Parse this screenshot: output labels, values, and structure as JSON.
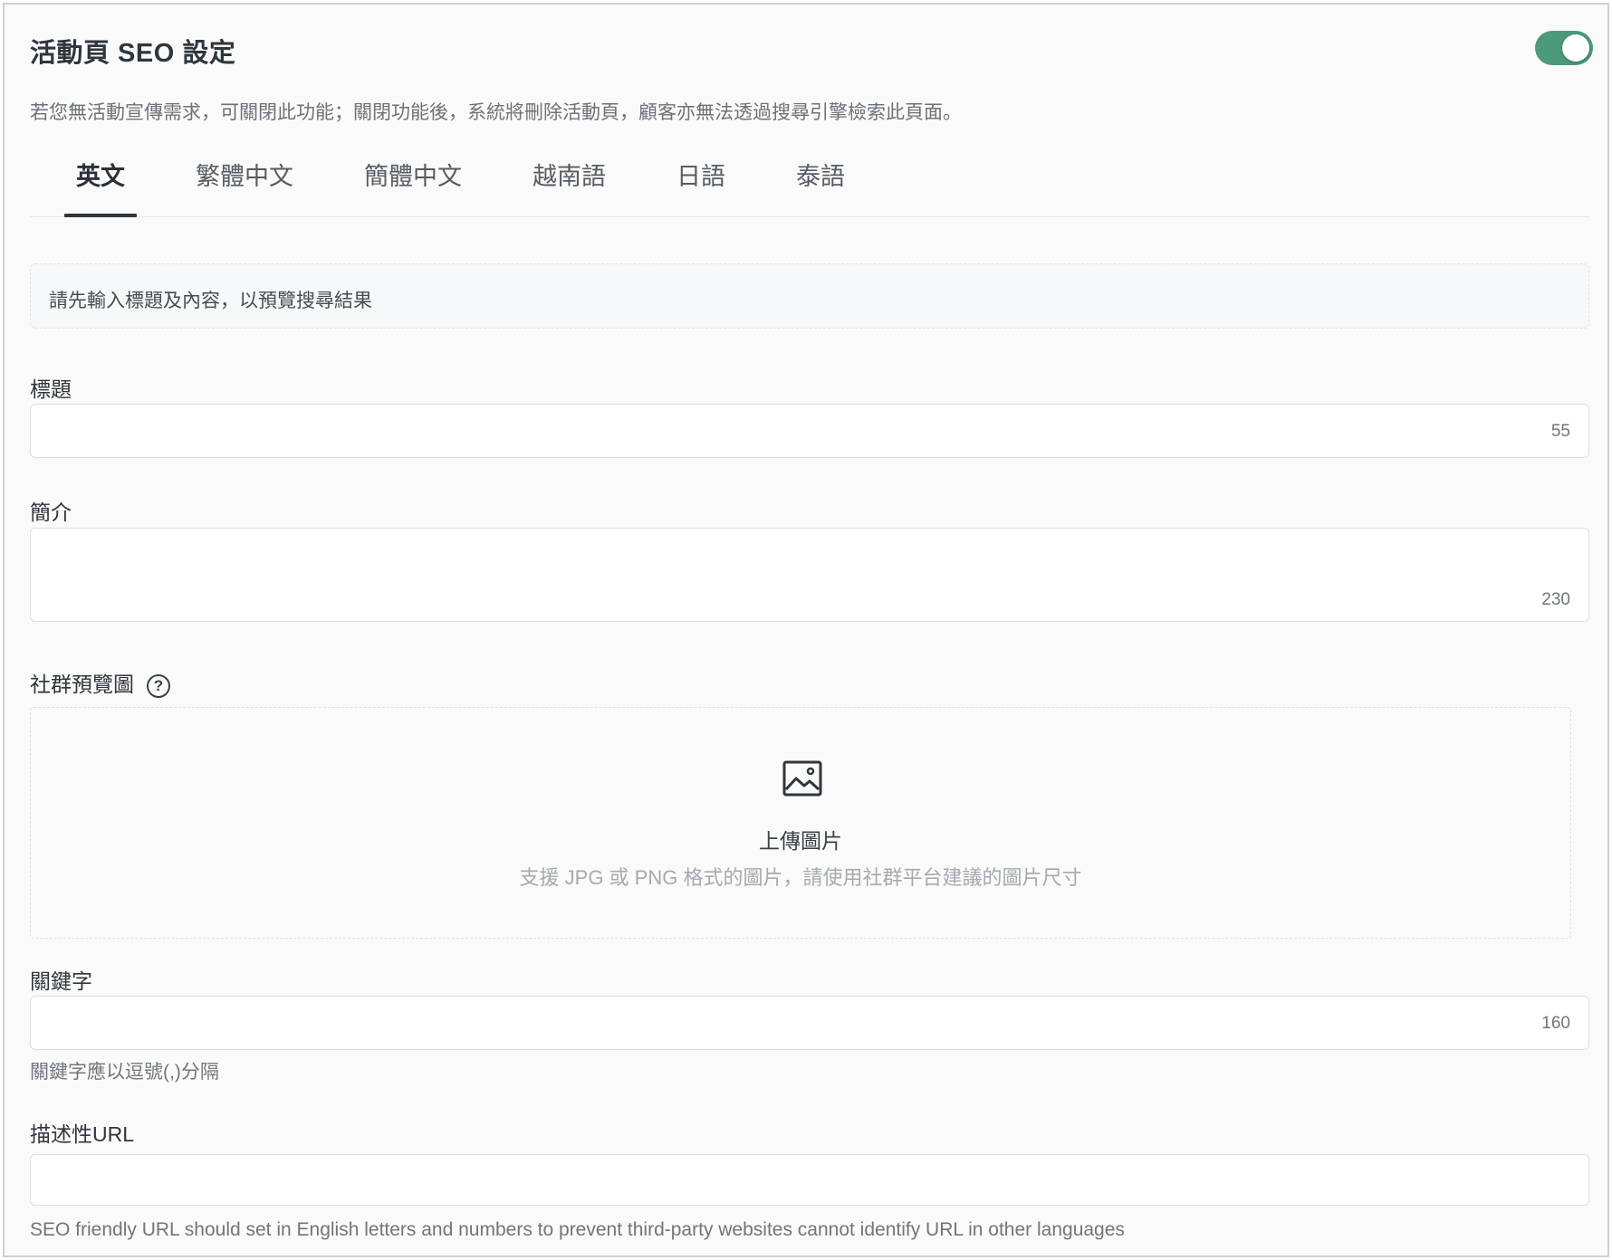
{
  "header": {
    "title": "活動頁 SEO 設定",
    "toggle_on": true,
    "description": "若您無活動宣傳需求，可關閉此功能；關閉功能後，系統將刪除活動頁，顧客亦無法透過搜尋引擎檢索此頁面。"
  },
  "tabs": [
    {
      "label": "英文",
      "active": true
    },
    {
      "label": "繁體中文",
      "active": false
    },
    {
      "label": "簡體中文",
      "active": false
    },
    {
      "label": "越南語",
      "active": false
    },
    {
      "label": "日語",
      "active": false
    },
    {
      "label": "泰語",
      "active": false
    }
  ],
  "preview": {
    "text": "請先輸入標題及內容，以預覽搜尋結果"
  },
  "fields": {
    "title": {
      "label": "標題",
      "value": "",
      "counter": "55"
    },
    "intro": {
      "label": "簡介",
      "value": "",
      "counter": "230"
    },
    "social_image": {
      "label": "社群預覽圖",
      "help_icon": "question-circle-icon",
      "upload_icon": "image-icon",
      "upload_title": "上傳圖片",
      "upload_hint": "支援 JPG 或 PNG 格式的圖片，請使用社群平台建議的圖片尺寸"
    },
    "keywords": {
      "label": "關鍵字",
      "value": "",
      "counter": "160",
      "hint": "關鍵字應以逗號(,)分隔"
    },
    "url": {
      "label": "描述性URL",
      "value": "",
      "hint": "SEO friendly URL should set in English letters and numbers to prevent third-party websites cannot identify URL in other languages"
    }
  },
  "colors": {
    "toggle_on": "#4b9a7b",
    "active_tab_underline": "#2f363c"
  }
}
